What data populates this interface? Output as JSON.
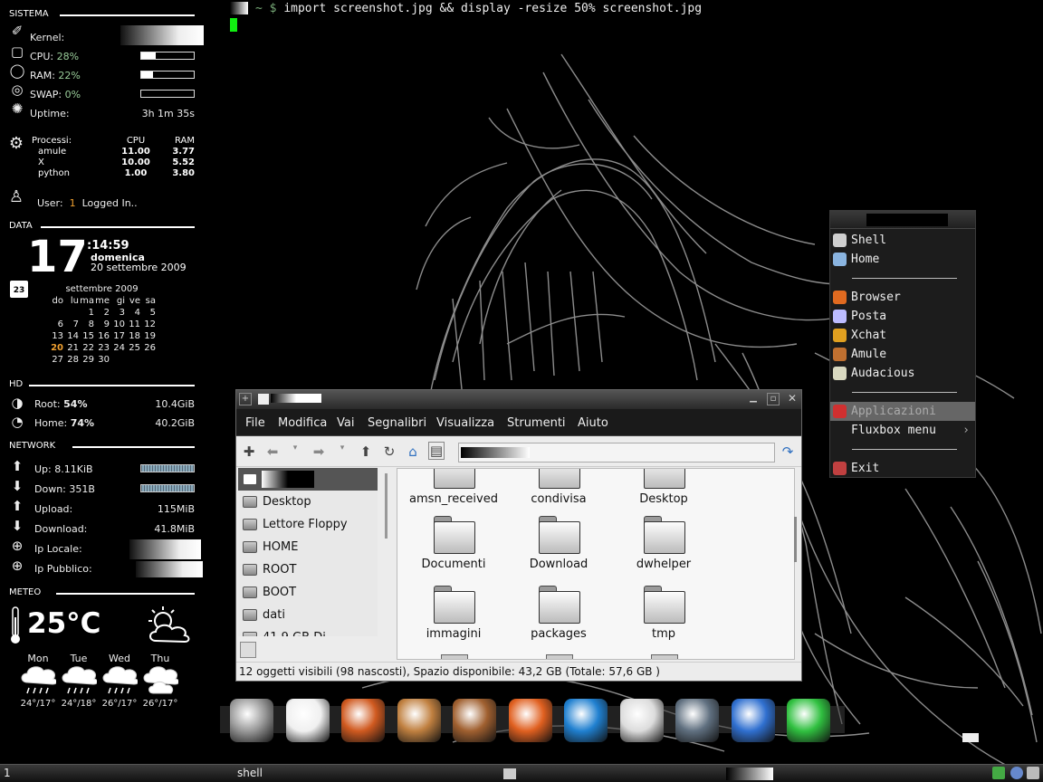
{
  "terminal": {
    "prompt_symbol": "$",
    "command": "import screenshot.jpg && display -resize 50% screenshot.jpg"
  },
  "conky": {
    "sistema": {
      "title": "SISTEMA",
      "kernel_label": "Kernel:",
      "cpu_label": "CPU:",
      "cpu_value": "28%",
      "cpu_fraction": 0.28,
      "ram_label": "RAM:",
      "ram_value": "22%",
      "ram_fraction": 0.22,
      "swap_label": "SWAP:",
      "swap_value": "0%",
      "swap_fraction": 0.0,
      "uptime_label": "Uptime:",
      "uptime_value": "3h 1m 35s"
    },
    "processi": {
      "label": "Processi:",
      "col_cpu": "CPU",
      "col_ram": "RAM",
      "rows": [
        {
          "name": "amule",
          "cpu": "11.00",
          "ram": "3.77"
        },
        {
          "name": "X",
          "cpu": "10.00",
          "ram": "5.52"
        },
        {
          "name": "python",
          "cpu": "1.00",
          "ram": "3.80"
        }
      ]
    },
    "user": {
      "label": "User:",
      "count": "1",
      "status": "Logged In.."
    },
    "data": {
      "title": "DATA",
      "day": "17",
      "time": ":14:59",
      "weekday": "domenica",
      "full_date": "20 settembre 2009",
      "cal_icon_day": "23",
      "month_title": "settembre 2009",
      "weekdays": [
        "do",
        "lu",
        "ma",
        "me",
        "gi",
        "ve",
        "sa"
      ],
      "weeks": [
        [
          "",
          "",
          "1",
          "2",
          "3",
          "4",
          "5"
        ],
        [
          "6",
          "7",
          "8",
          "9",
          "10",
          "11",
          "12"
        ],
        [
          "13",
          "14",
          "15",
          "16",
          "17",
          "18",
          "19"
        ],
        [
          "20",
          "21",
          "22",
          "23",
          "24",
          "25",
          "26"
        ],
        [
          "27",
          "28",
          "29",
          "30",
          "",
          "",
          ""
        ]
      ],
      "today": "20"
    },
    "hd": {
      "title": "HD",
      "root_label": "Root:",
      "root_pct": "54%",
      "root_size": "10.4GiB",
      "home_label": "Home:",
      "home_pct": "74%",
      "home_size": "40.2GiB"
    },
    "network": {
      "title": "NETWORK",
      "up_label": "Up:",
      "up_value": "8.11KiB",
      "down_label": "Down:",
      "down_value": "351B",
      "upload_label": "Upload:",
      "upload_value": "115MiB",
      "download_label": "Download:",
      "download_value": "41.8MiB",
      "ip_local_label": "Ip Locale:",
      "ip_public_label": "Ip Pubblico:"
    },
    "meteo": {
      "title": "METEO",
      "current_temp": "25°C",
      "forecast": [
        {
          "day": "Mon",
          "temp": "24°/17°"
        },
        {
          "day": "Tue",
          "temp": "24°/18°"
        },
        {
          "day": "Wed",
          "temp": "26°/17°"
        },
        {
          "day": "Thu",
          "temp": "26°/17°"
        }
      ]
    }
  },
  "fluxbox_menu": {
    "items": [
      {
        "label": "Shell",
        "icon": "terminal-icon",
        "color": "#cfcfcf"
      },
      {
        "label": "Home",
        "icon": "home-folder-icon",
        "color": "#8ab4e0"
      },
      {
        "label": "Browser",
        "icon": "firefox-icon",
        "color": "#e06a20"
      },
      {
        "label": "Posta",
        "icon": "mail-icon",
        "color": "#bcbcff"
      },
      {
        "label": "Xchat",
        "icon": "xchat-icon",
        "color": "#e0a020"
      },
      {
        "label": "Amule",
        "icon": "amule-icon",
        "color": "#c07030"
      },
      {
        "label": "Audacious",
        "icon": "audacious-icon",
        "color": "#d8d8c0"
      },
      {
        "label": "Applicazioni",
        "icon": "applications-icon",
        "color": "#d03030"
      },
      {
        "label": "Fluxbox menu",
        "icon": "fluxbox-icon",
        "color": "#1c1c1c"
      },
      {
        "label": "Exit",
        "icon": "exit-icon",
        "color": "#c04040"
      }
    ],
    "submenu_arrow": "›"
  },
  "file_manager": {
    "menu": [
      "File",
      "Modifica",
      "Vai",
      "Segnalibri",
      "Visualizza",
      "Strumenti",
      "Aiuto"
    ],
    "sidebar": [
      "Desktop",
      "Lettore Floppy",
      "HOME",
      "ROOT",
      "BOOT",
      "dati",
      "41,9 GB Di"
    ],
    "files": [
      {
        "name": "amsn_received"
      },
      {
        "name": "condivisa"
      },
      {
        "name": "Desktop"
      },
      {
        "name": "Documenti"
      },
      {
        "name": "Download"
      },
      {
        "name": "dwhelper"
      },
      {
        "name": "immagini"
      },
      {
        "name": "packages"
      },
      {
        "name": "tmp"
      }
    ],
    "status": "12 oggetti visibili (98 nascosti), Spazio disponibile: 43,2 GB (Totale: 57,6 GB )"
  },
  "dock": {
    "items": [
      {
        "icon": "system-monitor-icon",
        "color": "#9a9a9a"
      },
      {
        "icon": "alien-robot-icon",
        "color": "#f0f0f0"
      },
      {
        "icon": "firefox-icon",
        "color": "#d05a20"
      },
      {
        "icon": "thunderbird-mail-icon",
        "color": "#c08040"
      },
      {
        "icon": "amule-donkey-icon",
        "color": "#a06030"
      },
      {
        "icon": "burner-flame-icon",
        "color": "#e06020"
      },
      {
        "icon": "music-note-icon",
        "color": "#2080d0"
      },
      {
        "icon": "xchat-icon",
        "color": "#dcdcdc"
      },
      {
        "icon": "webcam-icon",
        "color": "#607080"
      },
      {
        "icon": "video-clapper-icon",
        "color": "#3070d0"
      },
      {
        "icon": "alienware-icon",
        "color": "#30c040"
      }
    ]
  },
  "taskbar": {
    "workspace": "1",
    "task": "shell"
  }
}
